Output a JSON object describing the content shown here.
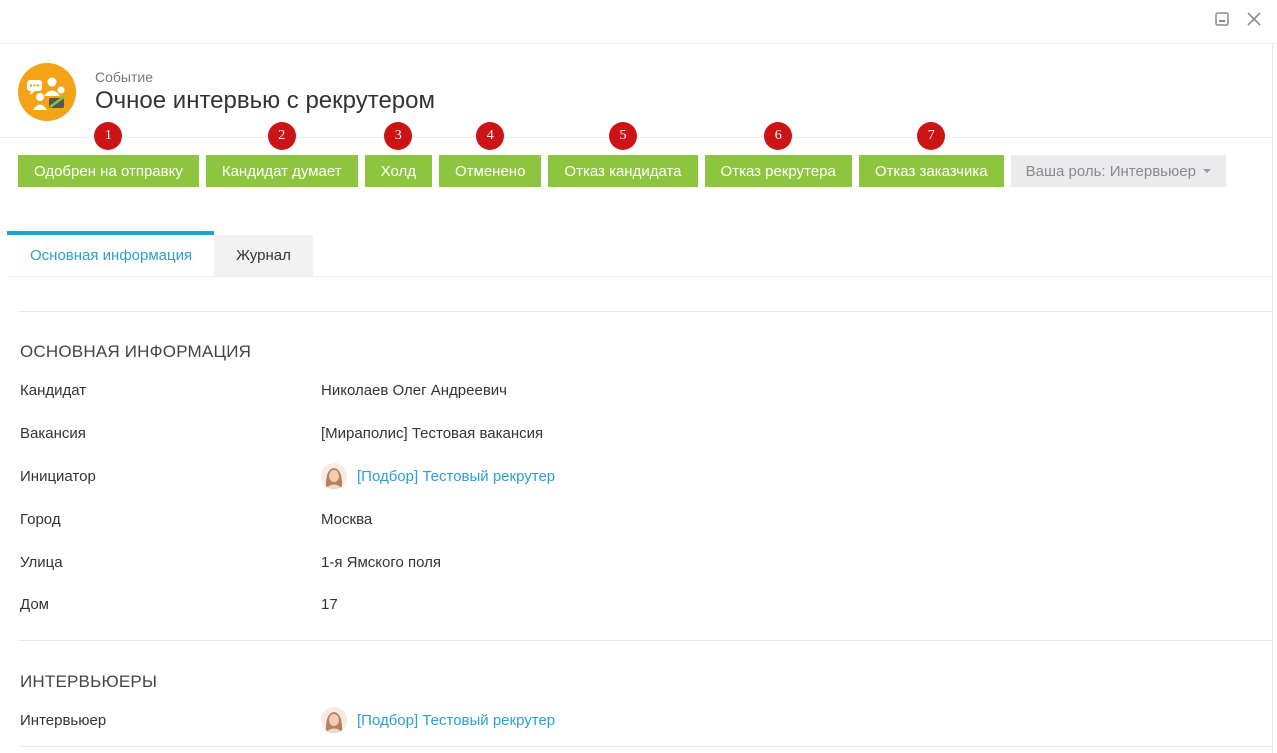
{
  "window": {
    "minimize_icon": "minimize-icon",
    "close_icon": "close-icon"
  },
  "header": {
    "icon": "interview-event-icon",
    "subtitle": "Событие",
    "title": "Очное интервью с рекрутером"
  },
  "actions": [
    {
      "label": "Одобрен на отправку",
      "badge": "1"
    },
    {
      "label": "Кандидат думает",
      "badge": "2"
    },
    {
      "label": "Холд",
      "badge": "3"
    },
    {
      "label": "Отменено",
      "badge": "4"
    },
    {
      "label": "Отказ кандидата",
      "badge": "5"
    },
    {
      "label": "Отказ рекрутера",
      "badge": "6"
    },
    {
      "label": "Отказ заказчика",
      "badge": "7"
    }
  ],
  "role": {
    "label": "Ваша роль: Интервьюер"
  },
  "tabs": [
    {
      "label": "Основная информация",
      "active": true
    },
    {
      "label": "Журнал",
      "active": false
    }
  ],
  "main_section": {
    "title": "ОСНОВНАЯ ИНФОРМАЦИЯ",
    "fields": [
      {
        "label": "Кандидат",
        "value": "Николаев Олег Андреевич"
      },
      {
        "label": "Вакансия",
        "value": "[Мираполис] Тестовая вакансия"
      },
      {
        "label": "Инициатор",
        "value": "[Подбор] Тестовый рекрутер"
      },
      {
        "label": "Город",
        "value": "Москва"
      },
      {
        "label": "Улица",
        "value": "1-я Ямского поля"
      },
      {
        "label": "Дом",
        "value": "17"
      }
    ]
  },
  "interviewers_section": {
    "title": "ИНТЕРВЬЮЕРЫ",
    "fields": [
      {
        "label": "Интервьюер",
        "value": "[Подбор] Тестовый рекрутер"
      }
    ]
  },
  "colors": {
    "action_green": "#8dc53e",
    "badge_red": "#cc1414",
    "link_blue": "#2a9fd6",
    "tab_accent": "#1ea1d4",
    "event_orange": "#f5a316"
  }
}
